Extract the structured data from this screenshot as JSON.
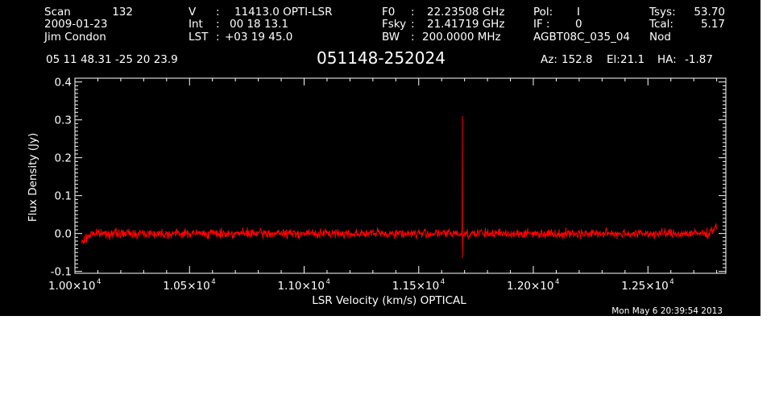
{
  "header": {
    "scan_label": "Scan",
    "scan_value": "132",
    "date": "2009-01-23",
    "observer": "Jim Condon",
    "v_label": "V",
    "v_sep": ":",
    "v_value": "11413.0 OPTI-LSR",
    "int_label": "Int",
    "int_sep": ":",
    "int_value": "00 18 13.1",
    "lst_label": "LST",
    "lst_sep": ":",
    "lst_value": "+03 19 45.0",
    "f0_label": "F0",
    "f0_sep": ":",
    "f0_value": "22.23508 GHz",
    "fsky_label": "Fsky",
    "fsky_sep": ":",
    "fsky_value": "21.41719 GHz",
    "bw_label": "BW",
    "bw_sep": ":",
    "bw_value": "200.0000 MHz",
    "pol_label": "Pol:",
    "pol_value": "I",
    "if_label": "IF :",
    "if_value": "0",
    "project": "AGBT08C_035_04",
    "tsys_label": "Tsys:",
    "tsys_value": "53.70",
    "tcal_label": "Tcal:",
    "tcal_value": "5.17",
    "procedure": "Nod",
    "coords": "05 11 48.31  -25 20 23.9",
    "source": "051148-252024",
    "az_label": "Az:",
    "az_value": "152.8",
    "el_label": "El:",
    "el_value": "21.1",
    "ha_label": "HA:",
    "ha_value": "-1.87"
  },
  "footer": {
    "timestamp": "Mon May  6 20:39:54 2013"
  },
  "colors": {
    "background": "#000000",
    "foreground": "#ffffff",
    "series": "#ff0000"
  },
  "chart_data": {
    "type": "line",
    "title": "051148-252024",
    "xlabel": "LSR Velocity (km/s) OPTICAL",
    "ylabel": "Flux Density (Jy)",
    "xlim": [
      10000,
      12840
    ],
    "ylim": [
      -0.105,
      0.41
    ],
    "x_ticks": [
      {
        "value": 10000,
        "mantissa": "1.00",
        "times": "×10",
        "exp": "4"
      },
      {
        "value": 10500,
        "mantissa": "1.05",
        "times": "×10",
        "exp": "4"
      },
      {
        "value": 11000,
        "mantissa": "1.10",
        "times": "×10",
        "exp": "4"
      },
      {
        "value": 11500,
        "mantissa": "1.15",
        "times": "×10",
        "exp": "4"
      },
      {
        "value": 12000,
        "mantissa": "1.20",
        "times": "×10",
        "exp": "4"
      },
      {
        "value": 12500,
        "mantissa": "1.25",
        "times": "×10",
        "exp": "4"
      }
    ],
    "y_ticks": [
      {
        "value": 0.4,
        "label": "0.4"
      },
      {
        "value": 0.3,
        "label": "0.3"
      },
      {
        "value": 0.2,
        "label": "0.2"
      },
      {
        "value": 0.1,
        "label": "0.1"
      },
      {
        "value": 0.0,
        "label": "0.0"
      },
      {
        "value": -0.1,
        "label": "-0.1"
      }
    ],
    "grid": false,
    "series": [
      {
        "color": "#ff0000",
        "x_start": 10030,
        "x_end": 12800,
        "baseline": 0.0,
        "noise_rms": 0.006,
        "features": [
          {
            "x": 10030,
            "y": -0.025
          },
          {
            "x": 10050,
            "y": -0.01
          },
          {
            "x": 10080,
            "y": 0.005
          },
          {
            "x": 11690,
            "y": 0.31
          },
          {
            "x": 11690,
            "y": -0.065
          },
          {
            "x": 12770,
            "y": 0.005
          },
          {
            "x": 12800,
            "y": 0.02
          }
        ]
      }
    ]
  }
}
